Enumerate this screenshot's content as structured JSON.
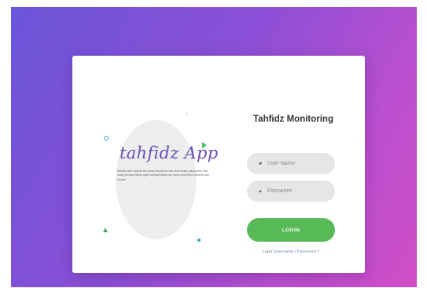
{
  "brand": {
    "logo_text": "tahfidz App",
    "description": "Bacaan dan hafalan Al-Quran beserta isi dan doa harian, yang perlu kita ulang dengan ikhlas agar menjadi bekal dan amal yang terus tumbuh dan berkah."
  },
  "login": {
    "title": "Tahfidz Monitoring",
    "username_placeholder": "User Name",
    "password_placeholder": "Password",
    "login_label": "LOGIN",
    "forgot_prefix": "Lupa",
    "forgot_username": "Username",
    "forgot_separator": " / ",
    "forgot_password": "Password ?"
  },
  "icons": {
    "user": "user-icon",
    "lock": "lock-icon"
  },
  "colors": {
    "gradient_start": "#6a55d9",
    "gradient_end": "#d04ec6",
    "login_button": "#58b957",
    "logo": "#6a4fb5"
  }
}
